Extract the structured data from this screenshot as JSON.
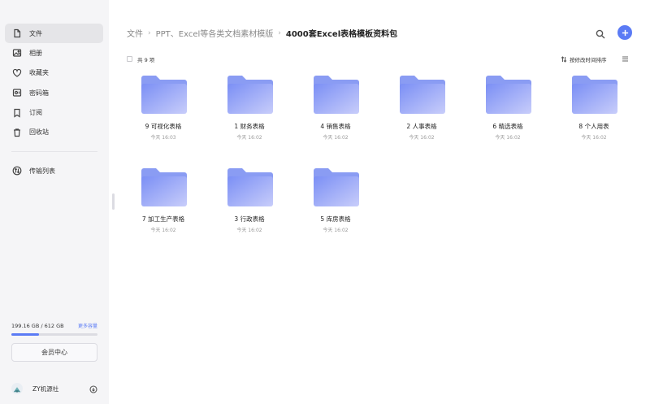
{
  "sidebar": {
    "items": [
      {
        "label": "文件",
        "icon": "file-icon",
        "active": true
      },
      {
        "label": "相册",
        "icon": "photo-icon",
        "active": false
      },
      {
        "label": "收藏夹",
        "icon": "heart-icon",
        "active": false
      },
      {
        "label": "密码箱",
        "icon": "safe-icon",
        "active": false
      },
      {
        "label": "订阅",
        "icon": "bookmark-icon",
        "active": false
      },
      {
        "label": "回收站",
        "icon": "trash-icon",
        "active": false
      }
    ],
    "transfer": {
      "label": "传输列表",
      "icon": "transfer-icon"
    },
    "storage": {
      "used_text": "199.16 GB / 612 GB",
      "more_label": "更多容量",
      "used_fraction": 0.325
    },
    "member_button": "会员中心",
    "user": {
      "name": "ZY机源社"
    }
  },
  "breadcrumb": {
    "items": [
      "文件",
      "PPT、Excel等各类文档素材模版"
    ],
    "current": "4000套Excel表格模板资料包",
    "separator": "›"
  },
  "toolbar": {
    "count": "共 9 项",
    "sort_label": "按修改时间排序"
  },
  "folders": [
    {
      "name": "9 可视化表格",
      "time": "今天 16:03"
    },
    {
      "name": "1 财务表格",
      "time": "今天 16:02"
    },
    {
      "name": "4 销售表格",
      "time": "今天 16:02"
    },
    {
      "name": "2 人事表格",
      "time": "今天 16:02"
    },
    {
      "name": "6 精选表格",
      "time": "今天 16:02"
    },
    {
      "name": "8 个人用表",
      "time": "今天 16:02"
    },
    {
      "name": "7 加工生产表格",
      "time": "今天 16:02"
    },
    {
      "name": "3 行政表格",
      "time": "今天 16:02"
    },
    {
      "name": "5 库房表格",
      "time": "今天 16:02"
    }
  ],
  "colors": {
    "accent": "#5b7bf5",
    "folder_back": "#8a9cf3",
    "folder_front_start": "#7b8ff5",
    "folder_front_end": "#c8cdfa"
  }
}
